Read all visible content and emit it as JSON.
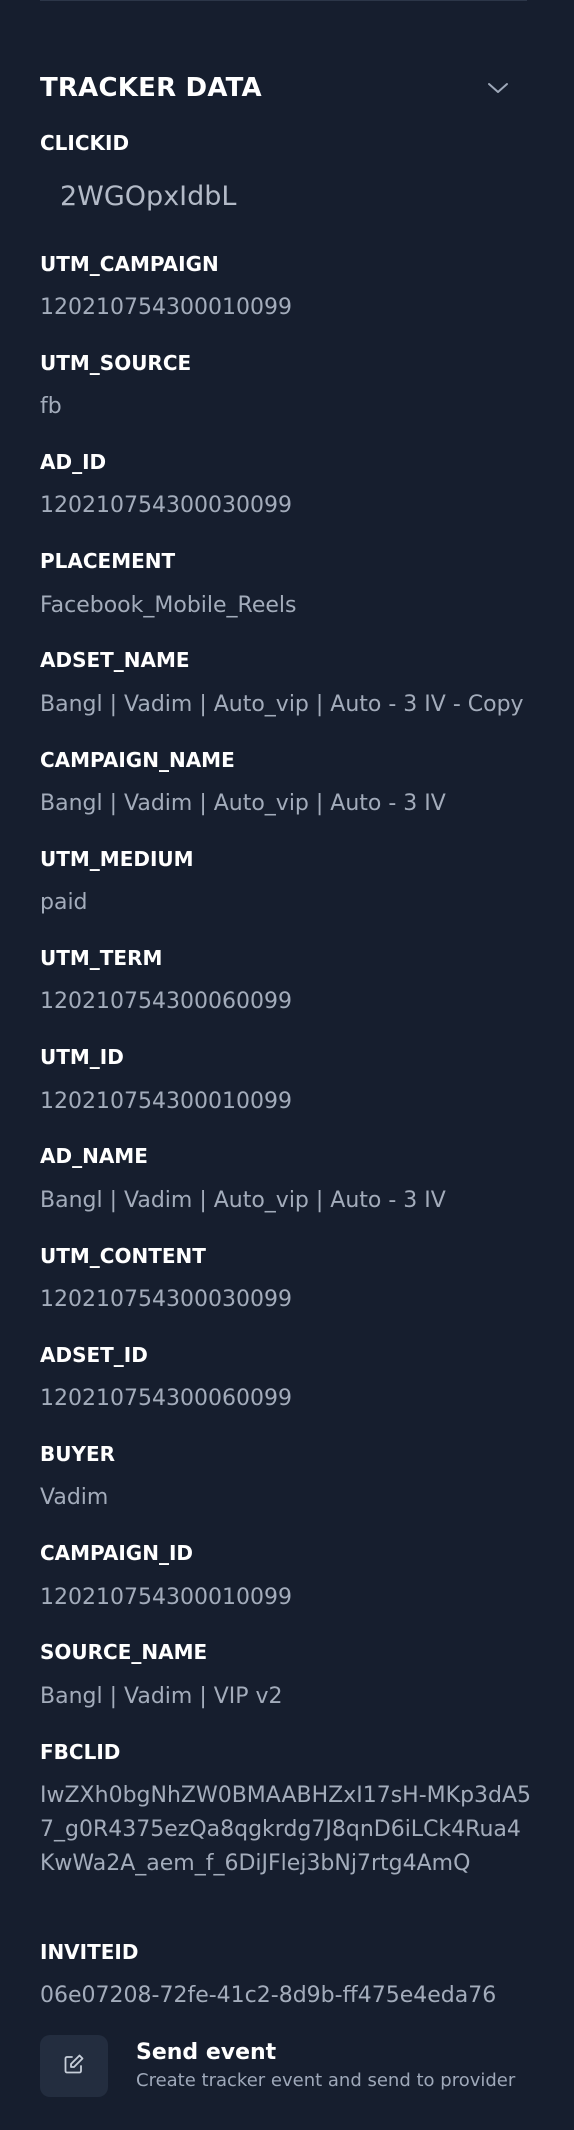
{
  "section": {
    "title": "TRACKER DATA"
  },
  "fields": [
    {
      "label": "CLICKID",
      "value": "2WGOpxIdbL"
    },
    {
      "label": "UTM_CAMPAIGN",
      "value": "120210754300010099"
    },
    {
      "label": "UTM_SOURCE",
      "value": "fb"
    },
    {
      "label": "AD_ID",
      "value": "120210754300030099"
    },
    {
      "label": "PLACEMENT",
      "value": "Facebook_Mobile_Reels"
    },
    {
      "label": "ADSET_NAME",
      "value": "Bangl | Vadim | Auto_vip | Auto - 3 IV - Copy"
    },
    {
      "label": "CAMPAIGN_NAME",
      "value": "Bangl | Vadim | Auto_vip | Auto - 3 IV"
    },
    {
      "label": "UTM_MEDIUM",
      "value": "paid"
    },
    {
      "label": "UTM_TERM",
      "value": "120210754300060099"
    },
    {
      "label": "UTM_ID",
      "value": "120210754300010099"
    },
    {
      "label": "AD_NAME",
      "value": "Bangl | Vadim | Auto_vip | Auto - 3 IV"
    },
    {
      "label": "UTM_CONTENT",
      "value": "120210754300030099"
    },
    {
      "label": "ADSET_ID",
      "value": "120210754300060099"
    },
    {
      "label": "BUYER",
      "value": "Vadim"
    },
    {
      "label": "CAMPAIGN_ID",
      "value": "120210754300010099"
    },
    {
      "label": "SOURCE_NAME",
      "value": "Bangl | Vadim | VIP v2"
    },
    {
      "label": "FBCLID",
      "value": "IwZXh0bgNhZW0BMAABHZxI17sH-MKp3dA57_g0R4375ezQa8qgkrdg7J8qnD6iLCk4Rua4KwWa2A_aem_f_6DiJFlej3bNj7rtg4AmQ"
    },
    {
      "label": "INVITEID",
      "value": "06e07208-72fe-41c2-8d9b-ff475e4eda76"
    }
  ],
  "send_event": {
    "title": "Send event",
    "subtitle": "Create tracker event and send to provider"
  },
  "icons": {
    "collapse": "chevron-down-icon",
    "send": "edit-icon"
  },
  "colors": {
    "background": "#161e2e",
    "label": "#ffffff",
    "value": "#a3acbb",
    "button_bg": "#232d3f"
  }
}
